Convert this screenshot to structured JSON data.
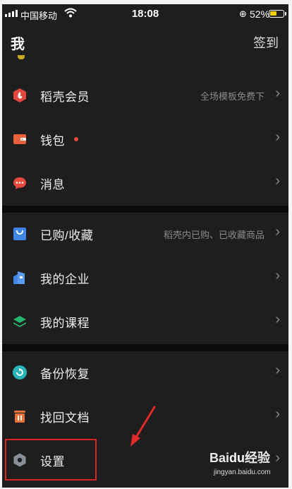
{
  "status_bar": {
    "carrier": "中国移动",
    "time": "18:08",
    "battery_percent": "52%",
    "battery_level": 0.52
  },
  "nav": {
    "title": "我",
    "checkin_label": "签到"
  },
  "menu": [
    {
      "label": "稻壳会员",
      "hint": "全场模板免费下",
      "icon": "flame-hexagon-icon",
      "color": "#e2483d"
    },
    {
      "label": "钱包",
      "hint": "",
      "icon": "wallet-icon",
      "color": "#e8603c",
      "badge_dot": true
    },
    {
      "label": "消息",
      "hint": "",
      "icon": "chat-bubble-icon",
      "color": "#e44a3a"
    },
    {
      "label": "已购/收藏",
      "hint": "稻壳内已购、已收藏商品",
      "icon": "shopping-bag-icon",
      "color": "#3f86e6"
    },
    {
      "label": "我的企业",
      "hint": "",
      "icon": "building-icon",
      "color": "#3f86e6"
    },
    {
      "label": "我的课程",
      "hint": "",
      "icon": "layers-icon",
      "color": "#25b26a"
    },
    {
      "label": "备份恢复",
      "hint": "",
      "icon": "backup-circle-icon",
      "color": "#27b3b8"
    },
    {
      "label": "找回文档",
      "hint": "",
      "icon": "trash-restore-icon",
      "color": "#e8703c"
    },
    {
      "label": "设置",
      "hint": "",
      "icon": "gear-hexagon-icon",
      "color": "#8a8f99"
    }
  ],
  "chevron": "›",
  "watermark": {
    "brand": "Bai",
    "paw": "du",
    "suffix": "经验",
    "url": "jingyan.baidu.com"
  }
}
